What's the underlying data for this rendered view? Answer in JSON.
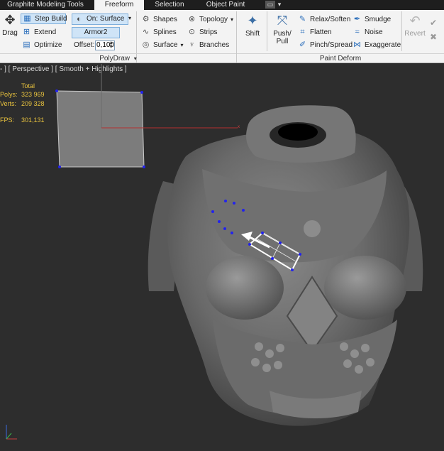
{
  "tabs": {
    "graphite": "Graphite Modeling Tools",
    "freeform": "Freeform",
    "selection": "Selection",
    "object_paint": "Object Paint"
  },
  "polydraw": {
    "drag_label": "Drag",
    "step_build_label": "Step Build",
    "extend_label": "Extend",
    "optimize_label": "Optimize",
    "on_surface_label": "On: Surface",
    "object_name": "Armor2",
    "offset_label": "Offset:",
    "offset_value": "0,100",
    "shapes_label": "Shapes",
    "splines_label": "Splines",
    "surface_label": "Surface",
    "topology_label": "Topology",
    "strips_label": "Strips",
    "branches_label": "Branches",
    "group_label": "PolyDraw"
  },
  "paint_deform": {
    "shift_label": "Shift",
    "push_label": "Push/",
    "pull_label": "Pull",
    "relax_label": "Relax/Soften",
    "flatten_label": "Flatten",
    "pinch_label": "Pinch/Spread",
    "smudge_label": "Smudge",
    "noise_label": "Noise",
    "exaggerate_label": "Exaggerate",
    "revert_label": "Revert",
    "group_label": "Paint Deform"
  },
  "viewport": {
    "label": "- ] [ Perspective ] [ Smooth + Highlights ]",
    "stats": {
      "total_header": "Total",
      "polys_label": "Polys:",
      "polys_value": "323 969",
      "verts_label": "Verts:",
      "verts_value": "209 328",
      "fps_label": "FPS:",
      "fps_value": "301,131"
    },
    "axis_x": "x"
  },
  "icons": [
    "move-icon",
    "step-build-icon",
    "extend-icon",
    "optimize-icon",
    "on-surface-icon",
    "shapes-icon",
    "splines-icon",
    "surface-icon",
    "topology-icon",
    "strips-icon",
    "branches-icon",
    "shift-icon",
    "push-pull-icon",
    "relax-icon",
    "flatten-icon",
    "pinch-icon",
    "smudge-icon",
    "noise-icon",
    "exaggerate-icon",
    "revert-icon",
    "check-icon",
    "close-icon",
    "dropdown-icon"
  ],
  "colors": {
    "ribbon_bg": "#f3f3f3",
    "tabbar_bg": "#1e1e1e",
    "viewport_bg": "#2d2d2d",
    "stats_text": "#e8c23e",
    "selection_blue": "#cfe4f7",
    "vertex_blue": "#2222ee"
  }
}
